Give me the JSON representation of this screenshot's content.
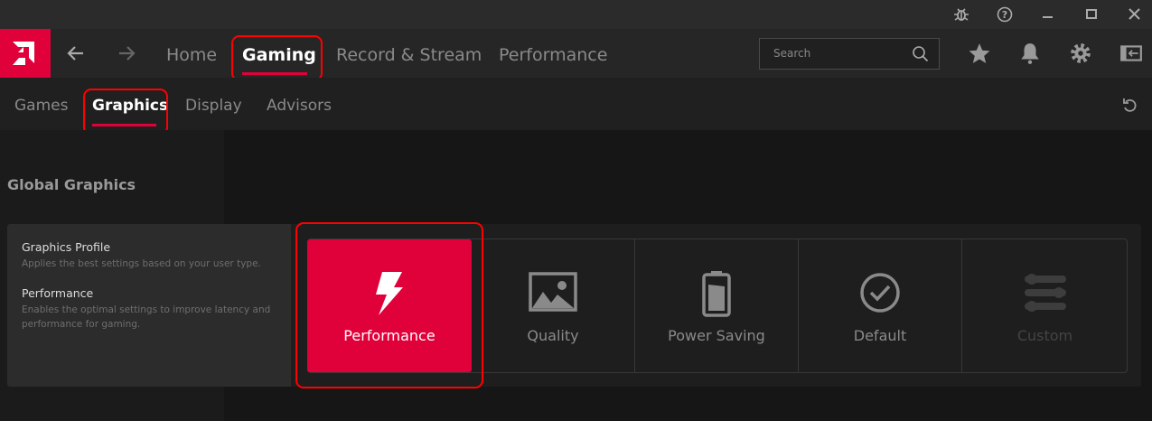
{
  "titlebar": {
    "icons": [
      "bug-icon",
      "help-icon",
      "minimize-icon",
      "maximize-icon",
      "close-icon"
    ]
  },
  "nav": {
    "items": [
      {
        "label": "Home"
      },
      {
        "label": "Gaming",
        "active": true
      },
      {
        "label": "Record & Stream"
      },
      {
        "label": "Performance"
      }
    ],
    "search_placeholder": "Search"
  },
  "subnav": {
    "items": [
      {
        "label": "Games"
      },
      {
        "label": "Graphics",
        "active": true
      },
      {
        "label": "Display"
      },
      {
        "label": "Advisors"
      }
    ]
  },
  "section": {
    "title": "Global Graphics"
  },
  "profile": {
    "title": "Graphics Profile",
    "subtitle": "Applies the best settings based on your user type.",
    "selected_title": "Performance",
    "selected_desc_line1": "Enables the optimal settings to improve latency and",
    "selected_desc_line2": "performance for gaming.",
    "cards": [
      {
        "label": "Performance",
        "selected": true
      },
      {
        "label": "Quality"
      },
      {
        "label": "Power Saving"
      },
      {
        "label": "Default"
      },
      {
        "label": "Custom",
        "disabled": true
      }
    ]
  },
  "colors": {
    "accent": "#e0003a",
    "annotation": "#ff0000"
  }
}
